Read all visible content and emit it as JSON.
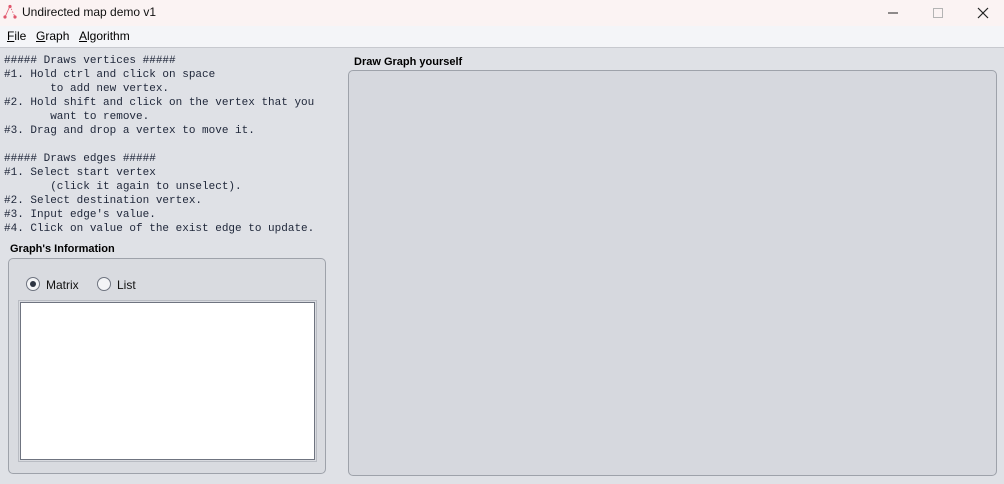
{
  "window": {
    "title": "Undirected map demo v1",
    "icon": "graph-app-icon"
  },
  "menu": [
    "File",
    "Graph",
    "Algorithm"
  ],
  "instructions": {
    "text": "##### Draws vertices #####\n#1. Hold ctrl and click on space\n       to add new vertex.\n#2. Hold shift and click on the vertex that you\n       want to remove.\n#3. Drag and drop a vertex to move it.\n\n##### Draws edges #####\n#1. Select start vertex\n       (click it again to unselect).\n#2. Select destination vertex.\n#3. Input edge's value.\n#4. Click on value of the exist edge to update."
  },
  "graph_info": {
    "title": "Graph's Information",
    "options": [
      {
        "label": "Matrix",
        "selected": true
      },
      {
        "label": "List",
        "selected": false
      }
    ],
    "output": ""
  },
  "draw_area": {
    "title": "Draw Graph yourself"
  },
  "colors": {
    "background": "#dfe1e6",
    "titlebar": "#fbf3f3",
    "panel": "#d6d8de",
    "app_icon": "#e0566c"
  }
}
